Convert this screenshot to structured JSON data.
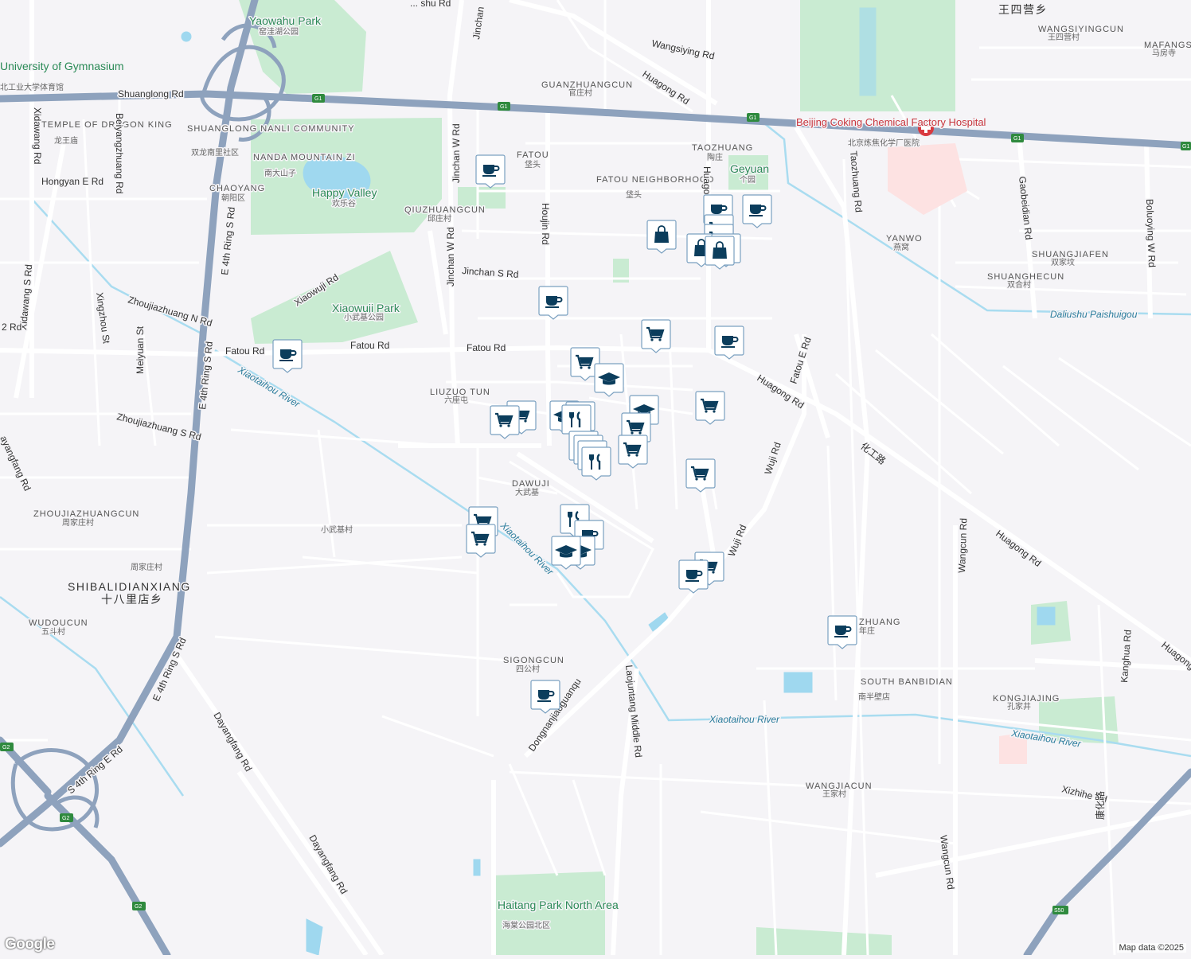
{
  "map": {
    "attribution": "Map data ©2025",
    "logo": "Google",
    "colors": {
      "background": "#f5f4f7",
      "park": "#c9ebd2",
      "water": "#9fd8ef",
      "highway": "#8ea2bd",
      "road": "#ffffff",
      "marker": "#ffffff",
      "marker_icon": "#0b3d5c",
      "hospital": "#d93a40"
    },
    "places": [
      {
        "en": "Yaowahu Park",
        "zh": "窑洼湖公园"
      },
      {
        "en": "University of Gymnasium",
        "zh": "北工业大学体育馆"
      },
      {
        "en": "TEMPLE OF DRAGON KING",
        "zh": "龙王庙"
      },
      {
        "en": "SHUANGLONG NANLI COMMUNITY",
        "zh": "双龙南里社区"
      },
      {
        "en": "CHAOYANG",
        "zh": "朝阳区"
      },
      {
        "en": "NANDA MOUNTAIN ZI",
        "zh": "南大山子"
      },
      {
        "en": "Happy Valley",
        "zh": "欢乐谷"
      },
      {
        "en": "QIUZHUANGCUN",
        "zh": "邱庄村"
      },
      {
        "en": "FATOU",
        "zh": "垡头"
      },
      {
        "en": "FATOU NEIGHBORHOOD",
        "zh": "垡头"
      },
      {
        "en": "TAOZHUANG",
        "zh": "陶庄"
      },
      {
        "en": "Geyuan",
        "zh": "个园"
      },
      {
        "en": "GUANZHUANGCUN",
        "zh": "官庄村"
      },
      {
        "en": "WANGSIYINGCUN",
        "zh": "王四营村"
      },
      {
        "en": "MAFANGSI",
        "zh": "马房寺"
      },
      {
        "en": "",
        "zh": "王四营乡"
      },
      {
        "en": "Beijing Coking Chemical Factory Hospital",
        "zh": "北京炼焦化学厂医院"
      },
      {
        "en": "YANWO",
        "zh": "燕窝"
      },
      {
        "en": "SHUANGJIAFEN",
        "zh": "双家坟"
      },
      {
        "en": "SHUANGHECUN",
        "zh": "双合村"
      },
      {
        "en": "Xiaowuji Park",
        "zh": "小武基公园"
      },
      {
        "en": "LIUZUO TUN",
        "zh": "六座屯"
      },
      {
        "en": "DAWUJI",
        "zh": "大武基"
      },
      {
        "en": "ZHOUJIAZHUANGCUN",
        "zh": "周家庄村"
      },
      {
        "en": "",
        "zh": "小武基村"
      },
      {
        "en": "",
        "zh": "周家庄村"
      },
      {
        "en": "SHIBALIDIANXIANG",
        "zh": "十八里店乡"
      },
      {
        "en": "WUDOUCUN",
        "zh": "五斗村"
      },
      {
        "en": "SIGONGCUN",
        "zh": "四公村"
      },
      {
        "en": "ZHUANG",
        "zh": "年庄"
      },
      {
        "en": "SOUTH BANBIDIAN",
        "zh": "南半壁店"
      },
      {
        "en": "KONGJIAJING",
        "zh": "孔家井"
      },
      {
        "en": "WANGJIACUN",
        "zh": "王家村"
      },
      {
        "en": "Haitang Park North Area",
        "zh": "海棠公园北区"
      }
    ],
    "roads": [
      "Shuanglong Rd",
      "Jinchan",
      "Wangsiying Rd",
      "Huagong Rd",
      "Hongyan E Rd",
      "Jinchan W Rd",
      "Houjin Rd",
      "Jinchan S Rd",
      "Fatou Rd",
      "Xiaowuji Rd",
      "Zhoujiazhuang N Rd",
      "Zhoujiazhuang S Rd",
      "Xidawang Rd",
      "Xidawang S Rd",
      "Beiyangzhuang Rd",
      "Xingzhou St",
      "Meiyuan St",
      "E 4th Ring S Rd",
      "Fatou E Rd",
      "Taozhuang Rd",
      "Gaobeidian Rd",
      "Boluoying W Rd",
      "Wuji Rd",
      "Wangcun Rd",
      "Kanghua Rd",
      "Xizhihe Rd",
      "Laojuntang Middle Rd",
      "Dongnanjiaoguanqu",
      "Dayangfang Rd",
      "S 4th Ring E Rd",
      "Huago",
      "Huagong Rd",
      "Daliushu Paishuigou",
      "Xiaotaihou River",
      "化工路",
      "康化路"
    ],
    "shields": [
      "G1",
      "G1",
      "G1",
      "G1",
      "G1",
      "G2",
      "G2",
      "G2",
      "S50"
    ]
  }
}
